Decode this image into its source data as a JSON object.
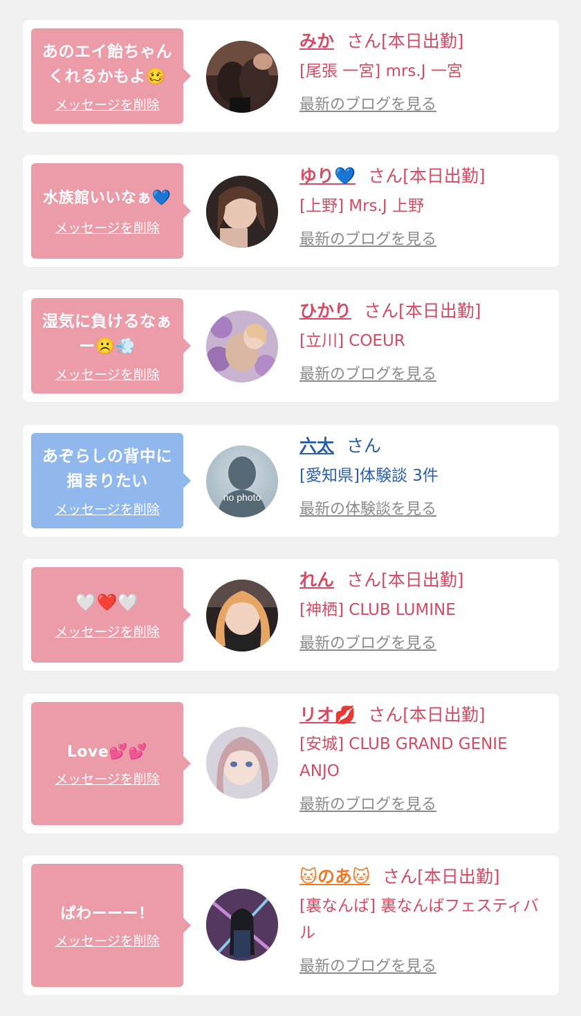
{
  "cards": [
    {
      "message": "あのエイ飴ちゃんくれるかもよ🥴",
      "delete_label": "メッセージを削除",
      "name": "みか",
      "name_suffix": "さん[本日出勤]",
      "shop": "[尾張 一宮] mrs.J 一宮",
      "blog_link": "最新のブログを見る",
      "theme": "pink"
    },
    {
      "message": "水族館いいなぁ💙",
      "delete_label": "メッセージを削除",
      "name": "ゆり💙",
      "name_suffix": "さん[本日出勤]",
      "shop": "[上野] Mrs.J 上野",
      "blog_link": "最新のブログを見る",
      "theme": "pink"
    },
    {
      "message": "湿気に負けるなぁー☹️💨",
      "delete_label": "メッセージを削除",
      "name": "ひかり",
      "name_suffix": "さん[本日出勤]",
      "shop": "[立川] COEUR",
      "blog_link": "最新のブログを見る",
      "theme": "pink"
    },
    {
      "message": "あぞらしの背中に掴まりたい",
      "delete_label": "メッセージを削除",
      "name": "六太",
      "name_suffix": "さん",
      "shop": "[愛知県]体験談 3件",
      "blog_link": "最新の体験談を見る",
      "avatar_label": "no photo",
      "theme": "blue"
    },
    {
      "message": "🤍❤️🤍",
      "delete_label": "メッセージを削除",
      "name": "れん",
      "name_suffix": "さん[本日出勤]",
      "shop": "[神栖] CLUB LUMINE",
      "blog_link": "最新のブログを見る",
      "theme": "pink"
    },
    {
      "message": "Love💕💕",
      "delete_label": "メッセージを削除",
      "name": "リオ💋",
      "name_suffix": "さん[本日出勤]",
      "shop": "[安城] CLUB GRAND GENIE ANJO",
      "blog_link": "最新のブログを見る",
      "theme": "pink"
    },
    {
      "message": "ぱわーーー！",
      "delete_label": "メッセージを削除",
      "name": "🐱のあ🐱",
      "name_suffix": "さん[本日出勤]",
      "shop": "[裏なんば] 裏なんばフェスティバル",
      "blog_link": "最新のブログを見る",
      "theme": "pink"
    }
  ]
}
